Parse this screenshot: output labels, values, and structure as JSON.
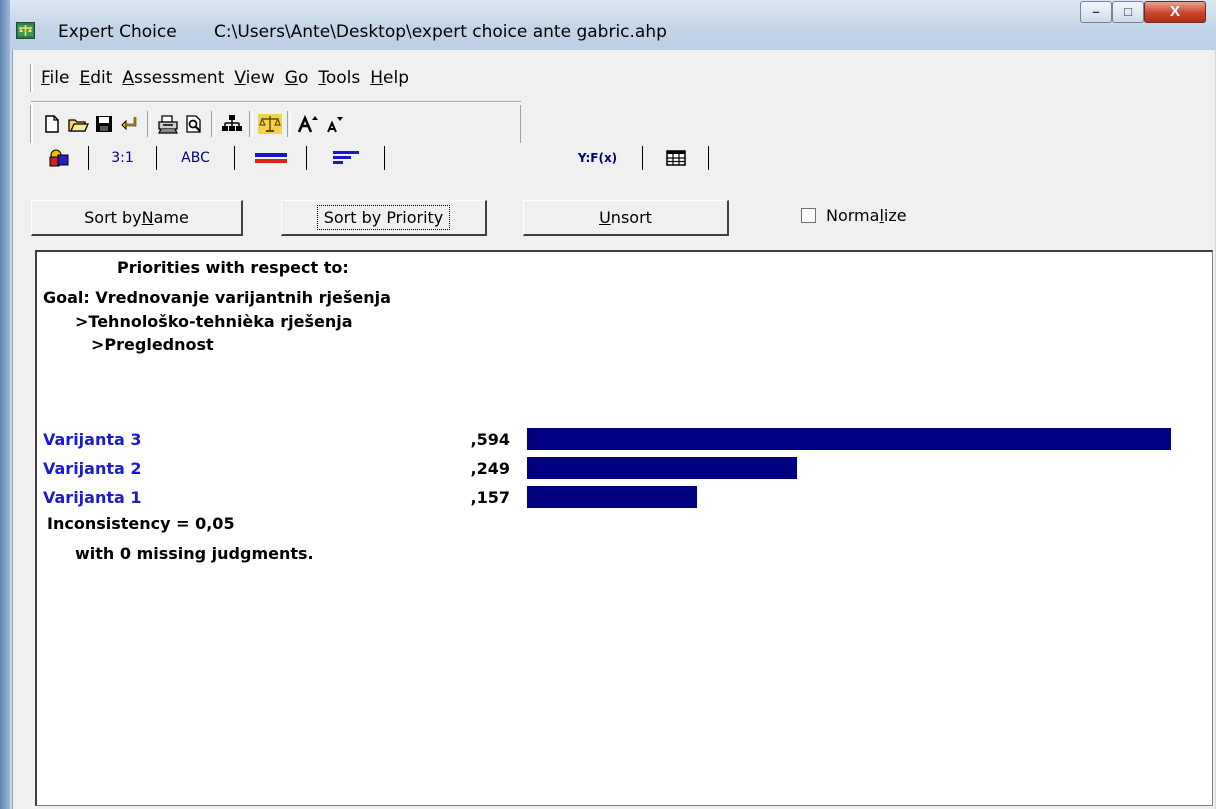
{
  "window": {
    "app_name": "Expert Choice",
    "file_path": "C:\\Users\\Ante\\Desktop\\expert choice ante gabric.ahp",
    "controls": {
      "minimize": "–",
      "maximize": "□",
      "close": "X"
    }
  },
  "menu": {
    "items": [
      {
        "pre": "",
        "u": "F",
        "post": "ile"
      },
      {
        "pre": "",
        "u": "E",
        "post": "dit"
      },
      {
        "pre": "",
        "u": "A",
        "post": "ssessment"
      },
      {
        "pre": "",
        "u": "V",
        "post": "iew"
      },
      {
        "pre": "",
        "u": "G",
        "post": "o"
      },
      {
        "pre": "",
        "u": "T",
        "post": "ools"
      },
      {
        "pre": "",
        "u": "H",
        "post": "elp"
      }
    ]
  },
  "toolbar": {
    "icons": [
      "new-file-icon",
      "open-folder-icon",
      "save-icon",
      "undo-icon",
      "print-icon",
      "print-preview-icon",
      "hierarchy-icon",
      "balance-scale-icon",
      "font-larger-icon",
      "font-smaller-icon"
    ]
  },
  "tabs": {
    "ratio": "3:1",
    "abc": "ABC",
    "formula": "Y:F(x)"
  },
  "sort": {
    "by_name_pre": "Sort by ",
    "by_name_u": "N",
    "by_name_post": "ame",
    "by_priority": "Sort by Priority",
    "unsort_u": "U",
    "unsort_post": "nsort",
    "normalize_pre": "Norma",
    "normalize_u": "l",
    "normalize_post": "ize",
    "normalize_checked": false
  },
  "report": {
    "heading": "Priorities with respect to:",
    "goal": "Goal: Vrednovanje varijantnih rješenja",
    "level1": ">Tehnološko-tehnièka rješenja",
    "level2": ">Preglednost",
    "inconsistency": "Inconsistency = 0,05",
    "missing": "with 0  missing judgments."
  },
  "chart_data": {
    "type": "bar",
    "orientation": "horizontal",
    "categories": [
      "Varijanta 3",
      "Varijanta 2",
      "Varijanta 1"
    ],
    "values": [
      0.594,
      0.249,
      0.157
    ],
    "value_labels": [
      ",594",
      ",249",
      ",157"
    ],
    "bar_color": "#000080",
    "label_color": "#1a1ad0"
  }
}
